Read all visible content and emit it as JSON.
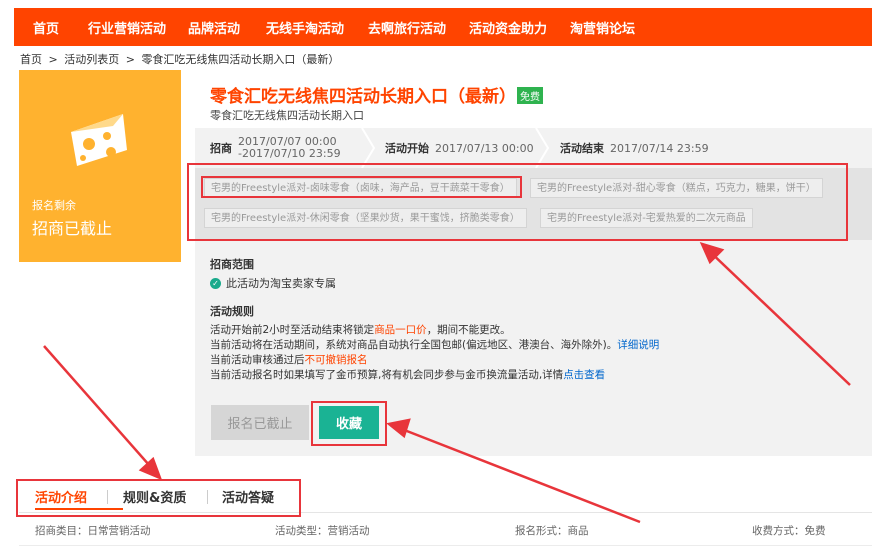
{
  "nav": {
    "items": [
      "首页",
      "行业营销活动",
      "品牌活动",
      "无线手淘活动",
      "去啊旅行活动",
      "活动资金助力",
      "淘营销论坛"
    ]
  },
  "breadcrumb": {
    "items": [
      "首页",
      "活动列表页",
      "零食汇吃无线焦四活动长期入口（最新）"
    ],
    "separator": ">"
  },
  "promo": {
    "sub_label": "报名剩余",
    "main_label": "招商已截止"
  },
  "activity": {
    "title": "零食汇吃无线焦四活动长期入口（最新）",
    "badge": "免费",
    "subtitle": "零食汇吃无线焦四活动长期入口"
  },
  "timeline": {
    "recruit_label": "招商",
    "recruit_start": "2017/07/07 00:00",
    "recruit_end": "-2017/07/10 23:59",
    "start_label": "活动开始",
    "start_time": "2017/07/13 00:00",
    "end_label": "活动结束",
    "end_time": "2017/07/14 23:59"
  },
  "categories": [
    "宅男的Freestyle派对-卤味零食（卤味，海产品，豆干蔬菜干零食）",
    "宅男的Freestyle派对-甜心零食（糕点，巧克力，糖果，饼干）",
    "宅男的Freestyle派对-休闲零食（坚果炒货，果干蜜饯，挤脆类零食）",
    "宅男的Freestyle派对-宅爱热爱的二次元商品"
  ],
  "scope": {
    "title": "招商范围",
    "item": "此活动为淘宝卖家专属"
  },
  "rules": {
    "title": "活动规则",
    "line1_a": "活动开始前2小时至活动结束将锁定",
    "line1_hl": "商品一口价",
    "line1_b": "，期间不能更改。",
    "line2_a": "当前活动将在活动期间，系统对商品自动执行全国包邮(偏远地区、港澳台、海外除外)。",
    "line2_link": "详细说明",
    "line3_a": "当前活动审核通过后",
    "line3_hl": "不可撤销报名",
    "line4_a": "当前活动报名时如果填写了金币预算,将有机会同步参与金币换流量活动,详情",
    "line4_link": "点击查看"
  },
  "buttons": {
    "closed": "报名已截止",
    "favorite": "收藏"
  },
  "tabs": [
    "活动介绍",
    "规则&资质",
    "活动答疑"
  ],
  "info": {
    "category": "招商类目：日常营销活动",
    "type": "活动类型：营销活动",
    "form": "报名形式：商品",
    "fee": "收费方式：免费"
  },
  "colors": {
    "brand": "#ff4400",
    "yellow": "#ffb22f",
    "teal": "#1ab394",
    "annotation": "#e8353b"
  }
}
